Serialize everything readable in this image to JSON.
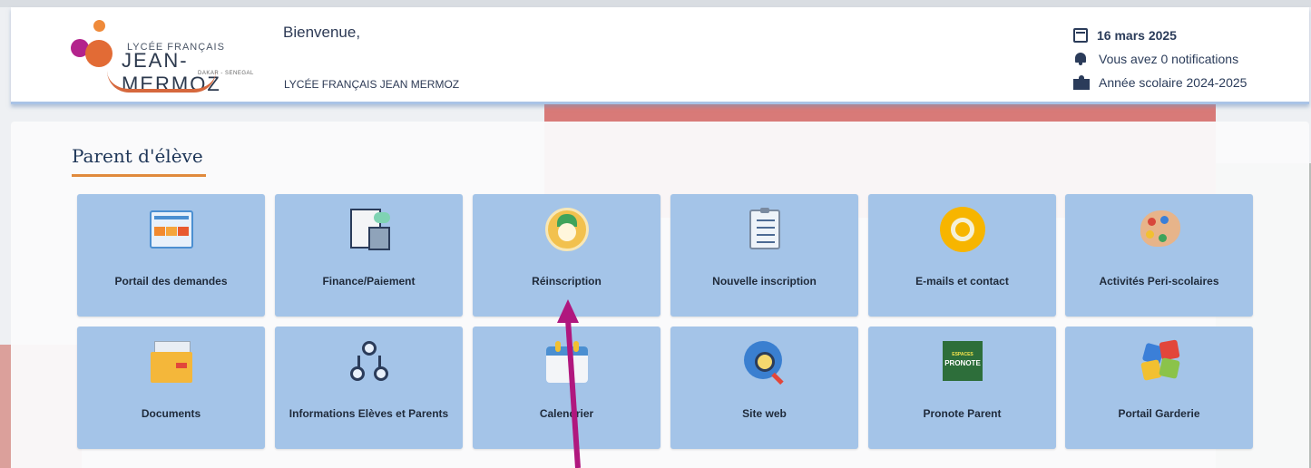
{
  "header": {
    "logo": {
      "line1": "LYCÉE FRANÇAIS",
      "line2": "JEAN-MERMOZ",
      "line3": "DAKAR - SENEGAL"
    },
    "welcome": "Bienvenue,",
    "school_name": "LYCÉE FRANÇAIS JEAN MERMOZ",
    "date": "16 mars 2025",
    "notifications": "Vous avez 0 notifications",
    "school_year": "Année scolaire 2024-2025"
  },
  "section": {
    "title": "Parent d'élève"
  },
  "tiles": [
    {
      "label": "Portail des demandes",
      "icon": "request-portal-icon"
    },
    {
      "label": "Finance/Paiement",
      "icon": "finance-icon"
    },
    {
      "label": "Réinscription",
      "icon": "reregistration-icon"
    },
    {
      "label": "Nouvelle inscription",
      "icon": "checklist-icon"
    },
    {
      "label": "E-mails et contact",
      "icon": "at-sign-icon"
    },
    {
      "label": "Activités Peri-scolaires",
      "icon": "palette-icon"
    },
    {
      "label": "Documents",
      "icon": "folder-icon"
    },
    {
      "label": "Informations Elèves et Parents",
      "icon": "people-network-icon"
    },
    {
      "label": "Calendrier",
      "icon": "calendar-icon"
    },
    {
      "label": "Site web",
      "icon": "globe-search-icon"
    },
    {
      "label": "Pronote Parent",
      "icon": "pronote-icon"
    },
    {
      "label": "Portail Garderie",
      "icon": "puzzle-icon"
    }
  ],
  "pronote_badge": {
    "top": "ESPACES",
    "bottom": "PRONOTE"
  },
  "colors": {
    "tile_bg": "#a4c4e8",
    "accent_underline": "#e08a3c",
    "annotation_arrow": "#b0177e",
    "header_text": "#2b3c5a"
  }
}
